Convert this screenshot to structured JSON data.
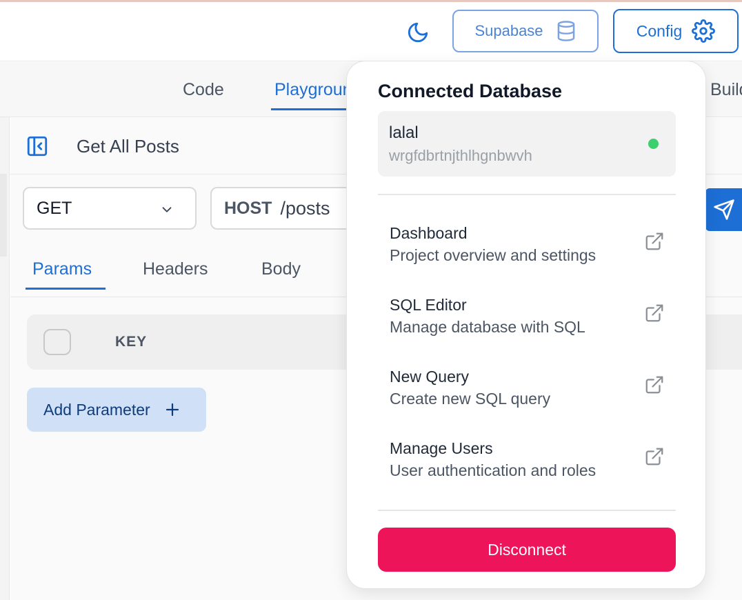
{
  "topbar": {
    "theme_icon": "moon-icon",
    "supabase_label": "Supabase",
    "supabase_icon": "database-icon",
    "config_label": "Config",
    "config_icon": "gear-icon"
  },
  "main_tabs": [
    {
      "label": "Code",
      "active": false
    },
    {
      "label": "Playground",
      "active": true
    },
    {
      "label": "Build",
      "active": false
    }
  ],
  "request": {
    "title": "Get All Posts",
    "method": "GET",
    "host": "HOST",
    "path": "/posts",
    "send_icon": "send-icon"
  },
  "sub_tabs": [
    {
      "label": "Params",
      "active": true
    },
    {
      "label": "Headers",
      "active": false
    },
    {
      "label": "Body",
      "active": false
    }
  ],
  "params_table": {
    "columns": [
      "KEY"
    ]
  },
  "add_parameter_label": "Add Parameter",
  "dropdown": {
    "title": "Connected Database",
    "database": {
      "name": "lalal",
      "ref": "wrgfdbrtnjthlhgnbwvh",
      "status_color": "#3ccf6e"
    },
    "items": [
      {
        "title": "Dashboard",
        "description": "Project overview and settings"
      },
      {
        "title": "SQL Editor",
        "description": "Manage database with SQL"
      },
      {
        "title": "New Query",
        "description": "Create new SQL query"
      },
      {
        "title": "Manage Users",
        "description": "User authentication and roles"
      }
    ],
    "disconnect_label": "Disconnect"
  },
  "colors": {
    "accent": "#1d6fd6",
    "danger": "#ee1459",
    "status_ok": "#3ccf6e"
  }
}
